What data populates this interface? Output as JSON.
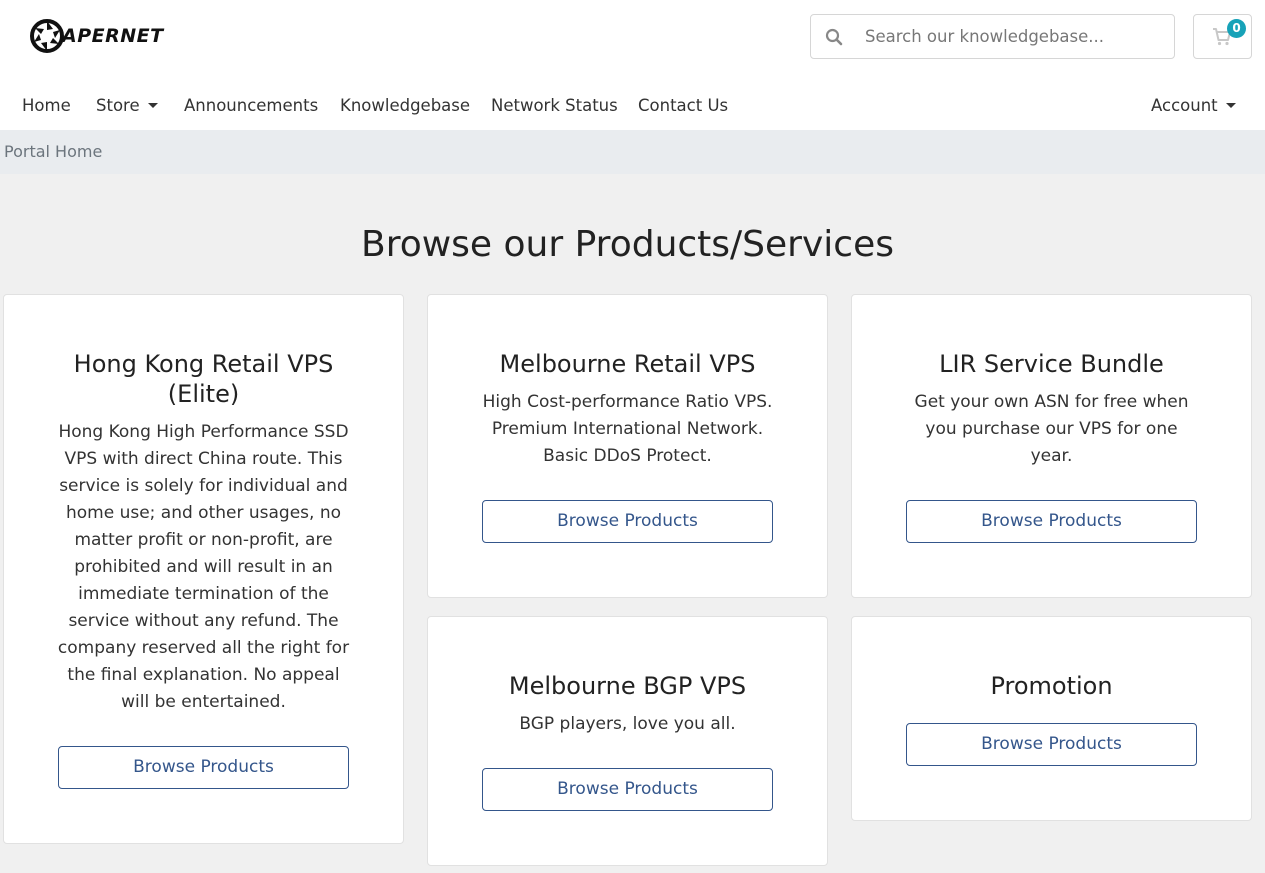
{
  "brand": {
    "name": "APERNET"
  },
  "search": {
    "placeholder": "Search our knowledgebase..."
  },
  "cart": {
    "count": "0"
  },
  "nav": {
    "home": "Home",
    "store": "Store",
    "announcements": "Announcements",
    "knowledgebase": "Knowledgebase",
    "network_status": "Network Status",
    "contact_us": "Contact Us",
    "account": "Account"
  },
  "breadcrumb": {
    "current": "Portal Home"
  },
  "page_title": "Browse our Products/Services",
  "products": [
    {
      "title": "Hong Kong Retail VPS (Elite)",
      "description": "Hong Kong High Performance SSD VPS with direct China route. This service is solely for individual and home use; and other usages, no matter profit or non-profit, are prohibited and will result in an immediate termination of the service without any refund. The company reserved all the right for the final explanation. No appeal will be entertained.",
      "button": "Browse Products"
    },
    {
      "title": "Melbourne Retail VPS",
      "description": "High Cost-performance Ratio VPS. Premium International Network. Basic DDoS Protect.",
      "button": "Browse Products"
    },
    {
      "title": "LIR Service Bundle",
      "description": "Get your own ASN for free when you purchase our VPS for one year.",
      "button": "Browse Products"
    },
    {
      "title": "Melbourne BGP VPS",
      "description": "BGP players, love you all.",
      "button": "Browse Products"
    },
    {
      "title": "Promotion",
      "description": "",
      "button": "Browse Products"
    }
  ],
  "colors": {
    "accent": "#34568b",
    "badge": "#17a2b8",
    "background": "#f0f0f0",
    "breadcrumb_bg": "#e9ecef"
  },
  "icons": {
    "logo": "aperture-logo-icon",
    "search": "search-icon",
    "cart": "shopping-cart-icon",
    "dropdown": "caret-down-icon"
  }
}
